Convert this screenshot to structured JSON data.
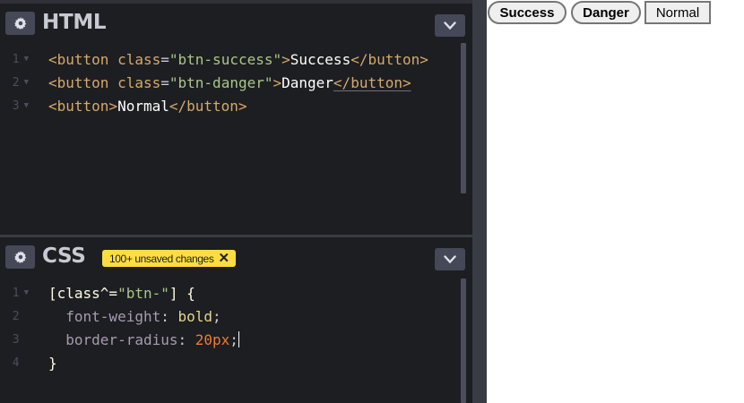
{
  "html_panel": {
    "title": "HTML",
    "lines": [
      {
        "num": "1",
        "tag_open": "<button",
        "attr": "class",
        "eq": "=",
        "str": "\"btn-success\"",
        "close_bracket": ">",
        "text": "Success",
        "tag_close": "</button>"
      },
      {
        "num": "2",
        "tag_open": "<button",
        "attr": "class",
        "eq": "=",
        "str": "\"btn-danger\"",
        "close_bracket": ">",
        "text": "Danger",
        "tag_close": "</button>"
      },
      {
        "num": "3",
        "tag_open": "<button>",
        "text": "Normal",
        "tag_close": "</button>"
      }
    ]
  },
  "css_panel": {
    "title": "CSS",
    "unsaved_badge": "100+ unsaved changes",
    "lines": [
      {
        "num": "1",
        "sel_open": "[class^=",
        "sel_str": "\"btn-\"",
        "sel_close": "]",
        "brace": " {"
      },
      {
        "num": "2",
        "prop": "font-weight",
        "colon": ": ",
        "val": "bold",
        "semi": ";"
      },
      {
        "num": "3",
        "prop": "border-radius",
        "colon": ": ",
        "val": "20px",
        "semi": ";"
      },
      {
        "num": "4",
        "brace": "}"
      }
    ]
  },
  "preview": {
    "buttons": [
      "Success",
      "Danger",
      "Normal"
    ]
  },
  "icons": {
    "settings": "gear-icon",
    "collapse": "chevron-down-icon",
    "badge_close": "close-icon"
  },
  "colors": {
    "editor_bg": "#1d1e22",
    "badge_bg": "#ffdd40",
    "tag": "#d5a96a",
    "string": "#a8c787",
    "number": "#ee7a34"
  }
}
